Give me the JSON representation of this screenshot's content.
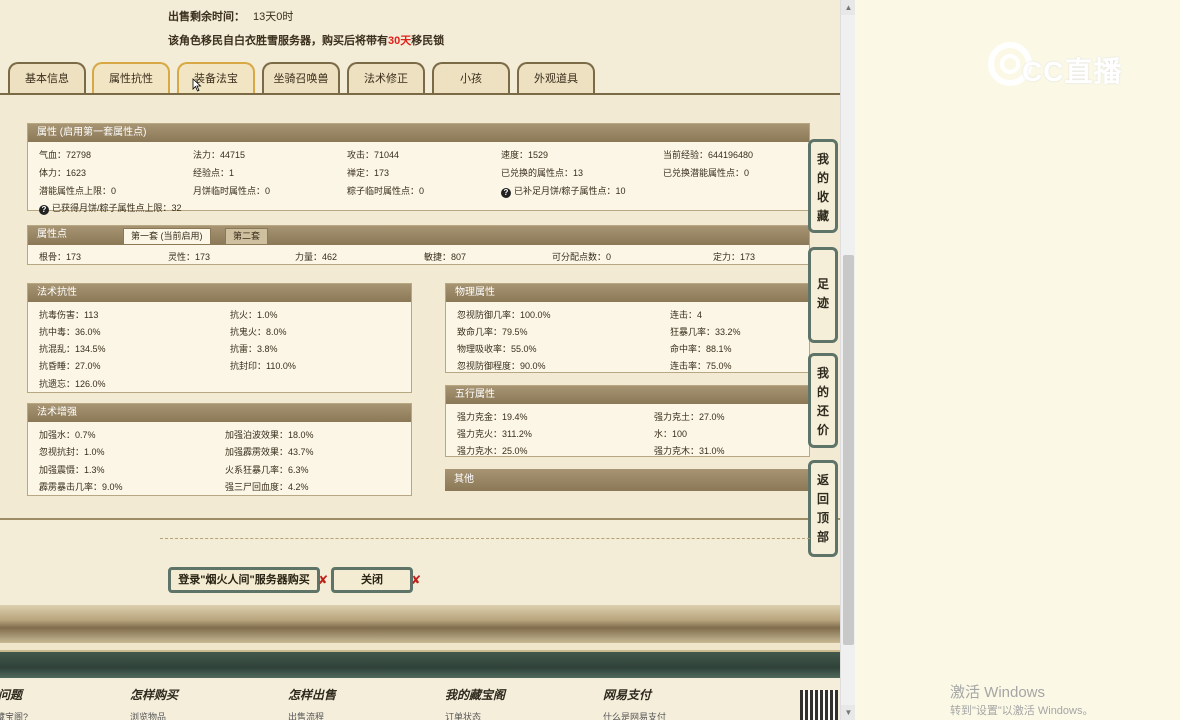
{
  "header": {
    "sale_time_label": "出售剩余时间：",
    "sale_time_value": "13天0时",
    "note_before": "该角色移民自白衣胜雪服务器，购买后将带有",
    "note_highlight": "30天",
    "note_after": "移民锁"
  },
  "tabs": [
    "基本信息",
    "属性抗性",
    "装备法宝",
    "坐骑召唤兽",
    "法术修正",
    "小孩",
    "外观道具"
  ],
  "attributes": {
    "title": "属性 (启用第一套属性点)",
    "rows": [
      [
        "气血：72798",
        "法力：44715",
        "攻击：71044",
        "速度：1529",
        "当前经验：644196480"
      ],
      [
        "体力：1623",
        "经验点：1",
        "禅定：173",
        "已兑换的属性点：13",
        "已兑换潜能属性点：0"
      ],
      [
        "潜能属性点上限：0",
        "月饼临时属性点：0",
        "粽子临时属性点：0",
        "已补足月饼/粽子属性点：10",
        ""
      ]
    ],
    "footnote": "已获得月饼/粽子属性点上限：32",
    "help_glyph": "?"
  },
  "attr_points": {
    "title": "属性点",
    "tab1": "第一套 (当前启用)",
    "tab2": "第二套",
    "values": [
      "根骨：173",
      "灵性：173",
      "力量：462",
      "敏捷：807",
      "可分配点数：0",
      "定力：173"
    ]
  },
  "spell_resist": {
    "title": "法术抗性",
    "rows": [
      [
        "抗毒伤害：113",
        "抗火：1.0%"
      ],
      [
        "抗中毒：36.0%",
        "抗鬼火：8.0%"
      ],
      [
        "抗混乱：134.5%",
        "抗雷：3.8%"
      ],
      [
        "抗昏睡：27.0%",
        "抗封印：110.0%"
      ],
      [
        "抗遗忘：126.0%",
        ""
      ]
    ]
  },
  "spell_boost": {
    "title": "法术增强",
    "rows": [
      [
        "加强水：0.7%",
        "加强泊波效果：18.0%"
      ],
      [
        "忽视抗封：1.0%",
        "加强霹雳效果：43.7%"
      ],
      [
        "加强震慑：1.3%",
        "火系狂暴几率：6.3%"
      ],
      [
        "霹雳暴击几率：9.0%",
        "强三尸回血度：4.2%"
      ]
    ]
  },
  "physical": {
    "title": "物理属性",
    "rows": [
      [
        "忽视防御几率：100.0%",
        "连击：4"
      ],
      [
        "致命几率：79.5%",
        "狂暴几率：33.2%"
      ],
      [
        "物理吸收率：55.0%",
        "命中率：88.1%"
      ],
      [
        "忽视防御程度：90.0%",
        "连击率：75.0%"
      ]
    ]
  },
  "five_elements": {
    "title": "五行属性",
    "rows": [
      [
        "强力克金：19.4%",
        "强力克土：27.0%"
      ],
      [
        "强力克火：311.2%",
        "水：100"
      ],
      [
        "强力克水：25.0%",
        "强力克木：31.0%"
      ]
    ]
  },
  "other": {
    "title": "其他"
  },
  "side_buttons": [
    [
      "我",
      "的",
      "收",
      "藏"
    ],
    [
      "足",
      "迹"
    ],
    [
      "我",
      "的",
      "还",
      "价"
    ],
    [
      "返",
      "回",
      "顶",
      "部"
    ]
  ],
  "actions": {
    "login_buy": "登录\"烟火人间\"服务器购买",
    "close": "关闭",
    "x_mark": "✘"
  },
  "footer": {
    "headings": [
      "问题",
      "怎样购买",
      "怎样出售",
      "我的藏宝阁",
      "网易支付"
    ],
    "subs": [
      "藏宝阁?",
      "浏览物品",
      "出售流程",
      "订单状态",
      "什么是网易支付"
    ]
  },
  "watermark": {
    "logo_text": "CC直播"
  },
  "windows_activation": {
    "line1": "激活 Windows",
    "line2": "转到\"设置\"以激活 Windows。"
  },
  "scrollbar": {
    "up": "▲",
    "down": "▼"
  },
  "colors": {
    "accent_red": "#e0201a",
    "side_border": "#5e7468",
    "section_head": "#8a7856"
  }
}
